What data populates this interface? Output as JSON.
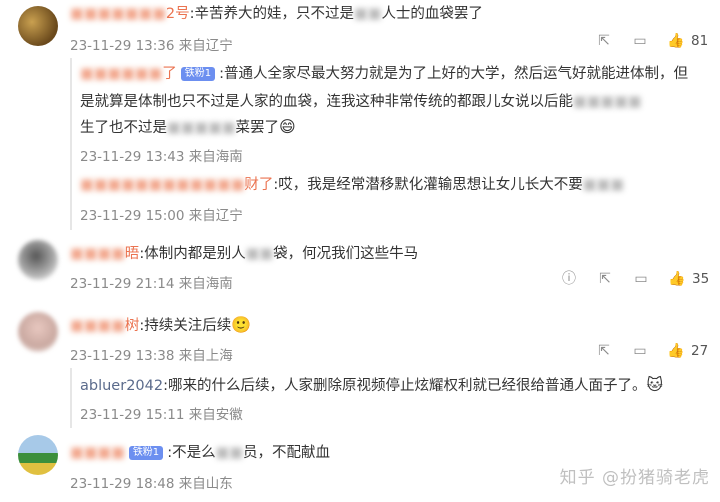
{
  "comments": [
    {
      "name_blur": "■■■■■■■",
      "name_suffix": "2号",
      "text_a": ":辛苦养大的娃，只不过是",
      "text_blur": "■■",
      "text_b": "人士的血袋罢了",
      "date": "23-11-29 13:36",
      "location": "来自辽宁",
      "likes": "81"
    },
    {
      "name_blur": "■■■■■■",
      "name_suffix": "了",
      "badge": "铁粉1",
      "line1": ":普通人全家尽最大努力就是为了上好的大学，然后运气好就能进体制，但",
      "line2_a": "是就算是体制也只不过是人家的血袋，连我这种非常传统的都跟儿女说以后能",
      "line2_blur": "■■■■■",
      "line3_a": "生了也不过是",
      "line3_blur": "■■■■■",
      "line3_b": "菜罢了",
      "date": "23-11-29 13:43",
      "location": "来自海南"
    },
    {
      "name_blur": "■■■■■■■■■■■■",
      "name_suffix": "财了",
      "text": ":哎，我是经常潜移默化灌输思想让女儿长大不要",
      "text_blur": "■■■",
      "date": "23-11-29 15:00",
      "location": "来自辽宁"
    },
    {
      "name_blur": "■■■■",
      "name_suffix": "晤",
      "text_a": ":体制内都是别人",
      "text_blur": "■■",
      "text_b": "袋，何况我们这些牛马",
      "date": "23-11-29 21:14",
      "location": "来自海南",
      "likes": "35"
    },
    {
      "name_blur": "■■■■",
      "name_suffix": "树",
      "text": ":持续关注后续",
      "date": "23-11-29 13:38",
      "location": "来自上海",
      "likes": "27"
    },
    {
      "name": "abluer2042",
      "text": ":哪来的什么后续，人家删除原视频停止炫耀权利就已经很给普通人面子了。",
      "date": "23-11-29 15:11",
      "location": "来自安徽"
    },
    {
      "name_blur": "■■■■",
      "badge": "铁粉1",
      "text_a": ":不是么",
      "text_blur": "■■",
      "text_b": "员，不配献血",
      "date": "23-11-29 18:48",
      "location": "来自山东"
    }
  ],
  "watermark": "知乎 @扮猪骑老虎",
  "icons": [
    "share-icon",
    "comment-icon",
    "like-icon"
  ]
}
